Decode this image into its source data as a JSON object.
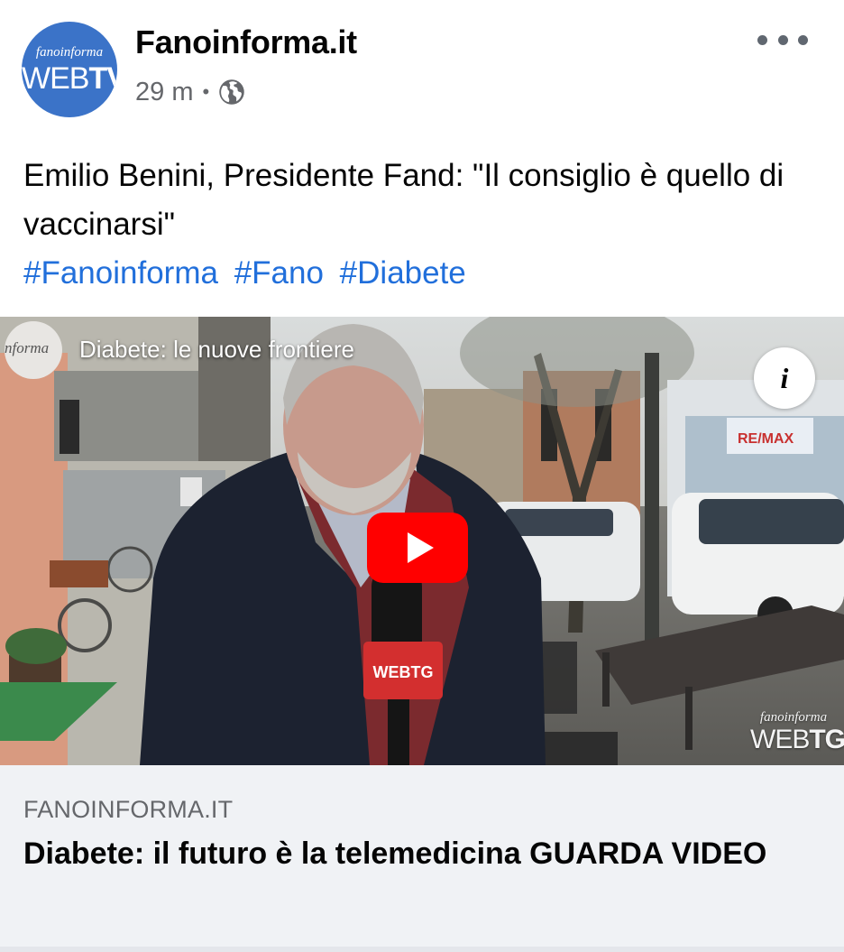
{
  "post": {
    "page_name": "Fanoinforma.it",
    "time": "29 m",
    "separator": "•",
    "privacy_icon": "globe-icon",
    "more_icon": "more-horizontal-icon",
    "avatar": {
      "small_text": "fanoinforma",
      "big_thin": "WEB",
      "big_bold": "TV"
    },
    "text": "Emilio Benini, Presidente Fand: \"Il consiglio è quello di vaccinarsi\"",
    "hashtags": [
      "#Fanoinforma",
      "#Fano",
      "#Diabete"
    ]
  },
  "video": {
    "channel_logo_text": "nforma",
    "title": "Diabete: le nuove frontiere",
    "info_label": "i",
    "play_icon": "youtube-play-icon",
    "mic_flag_text": "WEBTG",
    "watermark": {
      "small": "fanoinforma",
      "big_thin": "WEB",
      "big_bold": "TG"
    }
  },
  "link": {
    "domain": "FANOINFORMA.IT",
    "title": "Diabete: il futuro è la telemedicina GUARDA VIDEO"
  },
  "colors": {
    "link_blue": "#216fdb",
    "meta_grey": "#65676b",
    "card_bg": "#f0f2f5",
    "youtube_red": "#ff0000",
    "avatar_blue": "#3b73c8"
  }
}
